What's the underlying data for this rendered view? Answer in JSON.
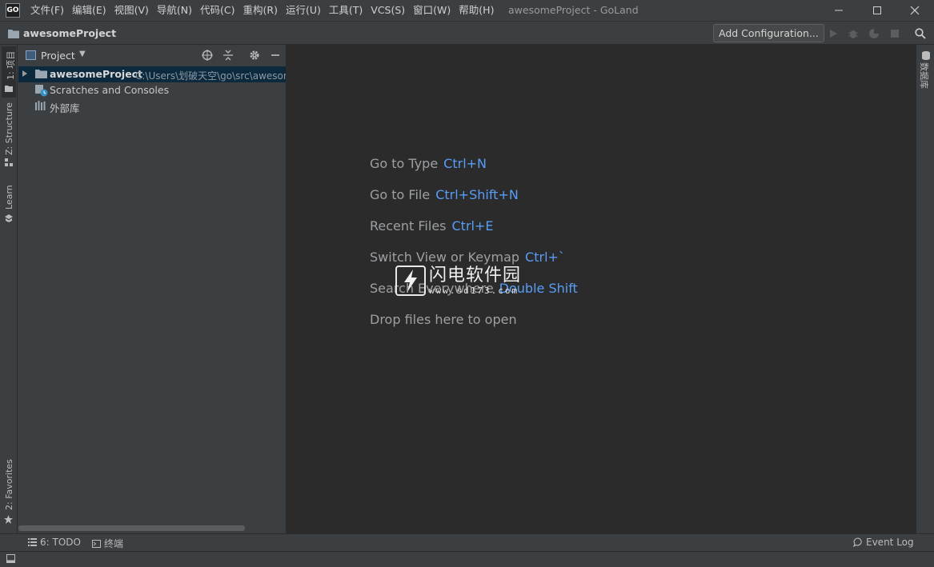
{
  "app": {
    "logo_text": "GO",
    "window_title": "awesomeProject - GoLand"
  },
  "menu": [
    {
      "label": "文件(F)"
    },
    {
      "label": "编辑(E)"
    },
    {
      "label": "视图(V)"
    },
    {
      "label": "导航(N)"
    },
    {
      "label": "代码(C)"
    },
    {
      "label": "重构(R)"
    },
    {
      "label": "运行(U)"
    },
    {
      "label": "工具(T)"
    },
    {
      "label": "VCS(S)"
    },
    {
      "label": "窗口(W)"
    },
    {
      "label": "帮助(H)"
    }
  ],
  "navbar": {
    "project_name": "awesomeProject",
    "add_configuration": "Add Configuration..."
  },
  "left_tabs": {
    "project": "1: 项目",
    "structure": "Z: Structure",
    "learn": "Learn",
    "favorites": "2: Favorites"
  },
  "right_tabs": {
    "database": "数据库"
  },
  "project_panel": {
    "title": "Project",
    "tree": [
      {
        "label": "awesomeProject",
        "path": "C:\\Users\\划破天空\\go\\src\\awesomeProject"
      },
      {
        "label": "Scratches and Consoles"
      },
      {
        "label": "外部库"
      }
    ]
  },
  "editor_hints": [
    {
      "text": "Go to Type",
      "key": "Ctrl+N"
    },
    {
      "text": "Go to File",
      "key": "Ctrl+Shift+N"
    },
    {
      "text": "Recent Files",
      "key": "Ctrl+E"
    },
    {
      "text": "Switch View or Keymap",
      "key": "Ctrl+`"
    },
    {
      "text": "Search Everywhere",
      "key": "Double Shift"
    },
    {
      "text": "Drop files here to open",
      "key": ""
    }
  ],
  "watermark": {
    "name": "闪电软件园",
    "url": "www.sd173.com"
  },
  "bottom_tabs": {
    "todo": "6: TODO",
    "terminal": "终端",
    "event_log": "Event Log"
  },
  "colors": {
    "editor_bg": "#2b2b2b",
    "panel_bg": "#3c3f41",
    "shortcut_blue": "#589df6",
    "selection": "#0d293e"
  }
}
